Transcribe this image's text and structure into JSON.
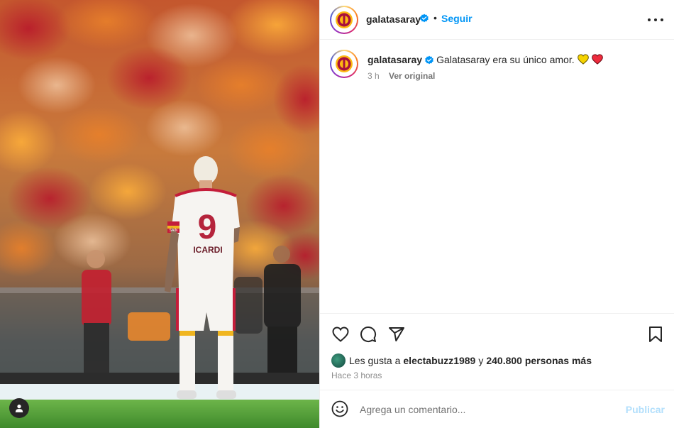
{
  "post": {
    "username": "galatasaray",
    "follow_label": "Seguir",
    "separator": "•",
    "caption_text": "Galatasaray era su único amor.",
    "caption_emojis": [
      "yellow-heart-icon",
      "red-heart-icon"
    ],
    "caption_age": "3 h",
    "see_original_label": "Ver original",
    "likes_prefix": "Les gusta a",
    "liked_by": "electabuzz1989",
    "likes_connector": "y",
    "likes_others": "240.800 personas más",
    "timestamp": "Hace 3 horas",
    "comment_placeholder": "Agrega un comentario...",
    "publish_label": "Publicar"
  },
  "photo": {
    "player_number": "9",
    "player_name": "ICARDI",
    "captain_band": "SAIN"
  },
  "colors": {
    "accent_blue": "#0095f6",
    "verified_blue": "#0095f6",
    "publish_disabled": "#b2dffc",
    "heart_red": "#ed2b3d",
    "heart_yellow": "#f5d300",
    "galatasaray_red": "#a9113c",
    "galatasaray_yellow": "#fdb913"
  },
  "icons": {
    "header": [
      "galatasaray-logo-icon",
      "verified-badge-icon",
      "more-options-icon"
    ],
    "actions": [
      "like-heart-icon",
      "comment-icon",
      "share-icon",
      "save-bookmark-icon"
    ],
    "comment": [
      "emoji-smile-icon"
    ],
    "media": [
      "tagged-user-icon"
    ]
  }
}
